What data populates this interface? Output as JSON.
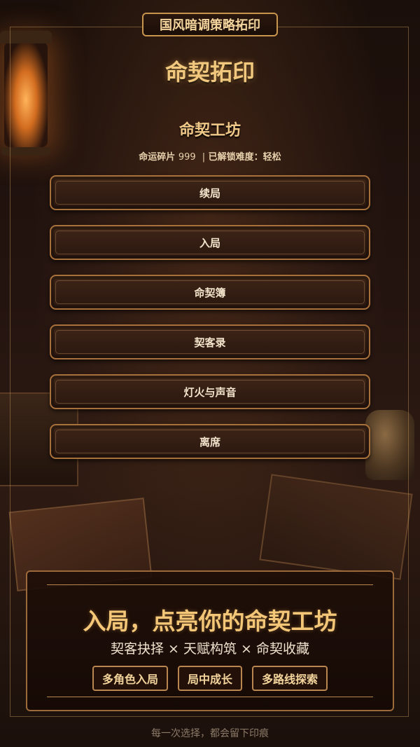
{
  "badge": {
    "label": "国风暗调策略拓印"
  },
  "header": {
    "title": "命契拓印"
  },
  "workshop": {
    "title": "命契工坊",
    "stats_label": "命运碎片",
    "stats_value": "999",
    "separator": "|",
    "difficulty_label": "已解锁难度：",
    "difficulty_value": "轻松"
  },
  "menu": {
    "items": [
      {
        "label": "续局"
      },
      {
        "label": "入局"
      },
      {
        "label": "命契簿"
      },
      {
        "label": "契客录"
      },
      {
        "label": "灯火与声音"
      },
      {
        "label": "离席"
      }
    ]
  },
  "promo": {
    "headline": "入局，点亮你的命契工坊",
    "tagline": "契客抉择 × 天赋构筑 × 命契收藏",
    "tags": [
      "多角色入局",
      "局中成长",
      "多路线探索"
    ]
  },
  "footer": {
    "text": "每一次选择，都会留下印痕"
  },
  "colors": {
    "accent": "#f1c87d",
    "border": "#a8703a",
    "background": "#1a0f0a"
  }
}
